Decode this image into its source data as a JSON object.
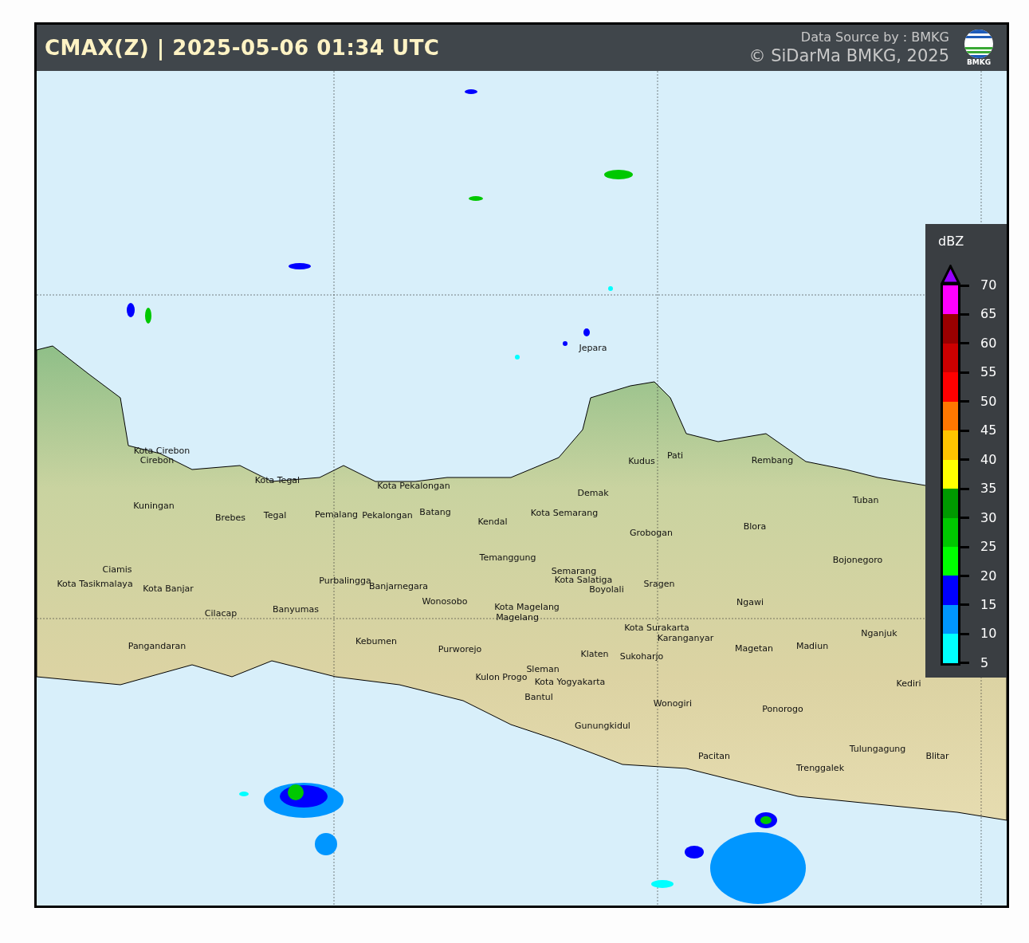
{
  "header": {
    "title": "CMAX(Z) | 2025-05-06 01:34 UTC",
    "source": "Data Source by : BMKG",
    "copyright": "© SiDarMa BMKG, 2025",
    "logo_text": "BMKG"
  },
  "map": {
    "places": [
      "Jepara",
      "Kota Cirebon",
      "Cirebon",
      "Kota Tegal",
      "Kota Pekalongan",
      "Kuningan",
      "Brebes",
      "Tegal",
      "Pemalang",
      "Pekalongan",
      "Batang",
      "Kendal",
      "Demak",
      "Kota Semarang",
      "Kudus",
      "Pati",
      "Rembang",
      "Tuban",
      "Blora",
      "Grobogan",
      "Temanggung",
      "Semarang",
      "Kota Salatiga",
      "Boyolali",
      "Sragen",
      "Ngawi",
      "Bojonegoro",
      "Ciamis",
      "Kota Tasikmalaya",
      "Kota Banjar",
      "Purbalingga",
      "Banjarnegara",
      "Wonosobo",
      "Kota Magelang",
      "Magelang",
      "Cilacap",
      "Banyumas",
      "Kota Surakarta",
      "Karanganyar",
      "Magetan",
      "Madiun",
      "Nganjuk",
      "Pangandaran",
      "Kebumen",
      "Purworejo",
      "Klaten",
      "Sukoharjo",
      "Sleman",
      "Kulon Progo",
      "Kota Yogyakarta",
      "Bantul",
      "Kediri",
      "Wonogiri",
      "Ponorogo",
      "Gunungkidul",
      "Pacitan",
      "Tulungagung",
      "Blitar",
      "Trenggalek"
    ]
  },
  "legend": {
    "title": "dBZ",
    "bands": [
      {
        "kind": "arrow",
        "color": "#9900ff"
      },
      {
        "color": "#ff00ff"
      },
      {
        "color": "#990000"
      },
      {
        "color": "#cc0000"
      },
      {
        "color": "#ff0000"
      },
      {
        "color": "#ff7700"
      },
      {
        "color": "#ffc400"
      },
      {
        "color": "#ffff00"
      },
      {
        "color": "#009900"
      },
      {
        "color": "#00c800"
      },
      {
        "color": "#00ff00"
      },
      {
        "color": "#0000ff"
      },
      {
        "color": "#0096ff"
      },
      {
        "color": "#00ffff"
      }
    ],
    "ticks": [
      "70",
      "65",
      "60",
      "55",
      "50",
      "45",
      "40",
      "35",
      "30",
      "25",
      "20",
      "15",
      "10",
      "5"
    ]
  }
}
